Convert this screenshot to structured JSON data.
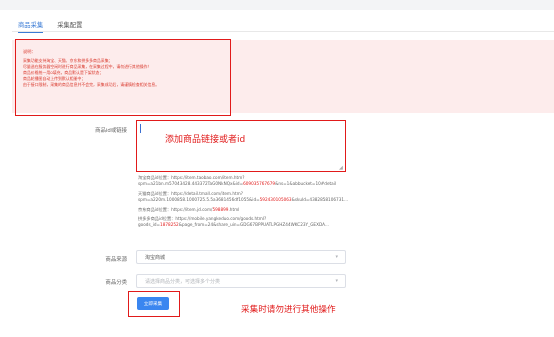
{
  "tabs": {
    "tab1": "商品采集",
    "tab2": "采集配置"
  },
  "notice": {
    "title": "说明：",
    "lines": [
      "采集功能支持淘宝、天猫、京东和拼多多商品采集；",
      "尽量选在服务器空闲时进行商品采集，在采集过程中，请勿进行其他操作！",
      "商品价格统一用0填充，商品默认是下架状态；",
      "商品轮播图自动上传到默认相册中；",
      "由于接口限制，采集的商品信息并不会完，采集成功后，请谨慎检查相关信息。"
    ]
  },
  "form": {
    "link_label": "商品id或链接",
    "link_hint": "添加商品链接或者id",
    "examples": {
      "taobao_prefix": "淘宝商品id位置：https://item.taobao.com/item.htm?",
      "taobao_line2_a": "spm=a21bn.m57043428.443372TaG0NkNQx&id=",
      "taobao_id": "609035767679",
      "taobao_line2_b": "&ns=1&abbucket=10#detail",
      "tmall_prefix": "天猫商品id位置：https://detail.tmall.com/item.htm?",
      "tmall_line2_a": "spm=a220m.1000858.1000725.5.5a3681456df1055&id=",
      "tmall_id": "592430105063",
      "tmall_line2_b": "&skuId=4382858106731...",
      "jd_prefix": "京东商品id位置：https://item.jd.com/",
      "jd_id": "598899",
      "jd_suffix": ".html",
      "pdd_prefix": "拼多多商品id位置：https://mobile.yangkeduo.com/goods.html?",
      "pdd_line2_a": "goods_id=",
      "pdd_id": "1878252",
      "pdd_line2_b": "&page_from=24&share_uin=GDG67BPPUATLPGHZ44WKC23Y_GEXDA..."
    },
    "source_label": "商品来源",
    "source_value": "淘宝商城",
    "category_label": "商品分类",
    "category_placeholder": "请选择商品分类，可选择多个分类",
    "submit_label": "立即采集",
    "op_hint": "采集时请勿进行其他操作"
  }
}
